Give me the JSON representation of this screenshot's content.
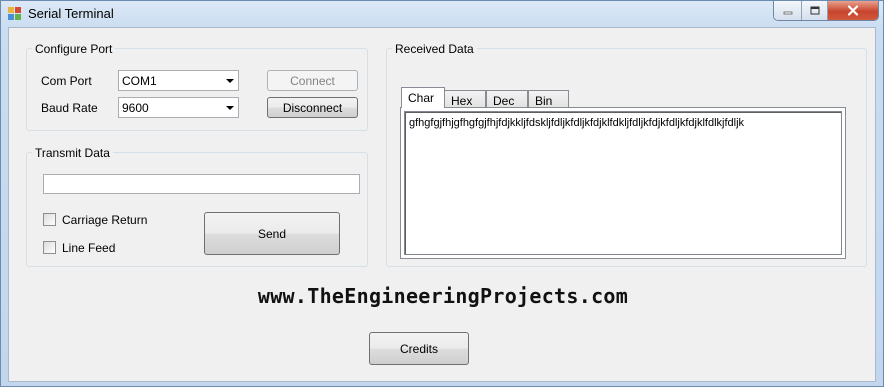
{
  "window": {
    "title": "Serial Terminal"
  },
  "configure_port": {
    "group_title": "Configure Port",
    "com_port_label": "Com Port",
    "com_port_value": "COM1",
    "baud_rate_label": "Baud Rate",
    "baud_rate_value": "9600",
    "connect_label": "Connect",
    "disconnect_label": "Disconnect"
  },
  "transmit": {
    "group_title": "Transmit Data",
    "input_value": "",
    "carriage_return_label": "Carriage Return",
    "carriage_return_checked": false,
    "line_feed_label": "Line Feed",
    "line_feed_checked": false,
    "send_label": "Send"
  },
  "received": {
    "group_title": "Received Data",
    "tabs": [
      {
        "label": "Char",
        "active": true
      },
      {
        "label": "Hex",
        "active": false
      },
      {
        "label": "Dec",
        "active": false
      },
      {
        "label": "Bin",
        "active": false
      }
    ],
    "text": "gfhgfgjfhjgfhgfgjfhjfdjkkljfdskljfdljkfdljkfdjklfdkljfdljkfdjkfdljkfdjklfdlkjfdljk"
  },
  "website": "www.TheEngineeringProjects.com",
  "credits_label": "Credits",
  "colors": {
    "close_button": "#c7452c",
    "window_frame": "#c2d6ee",
    "client_bg": "#f0f0f0"
  }
}
